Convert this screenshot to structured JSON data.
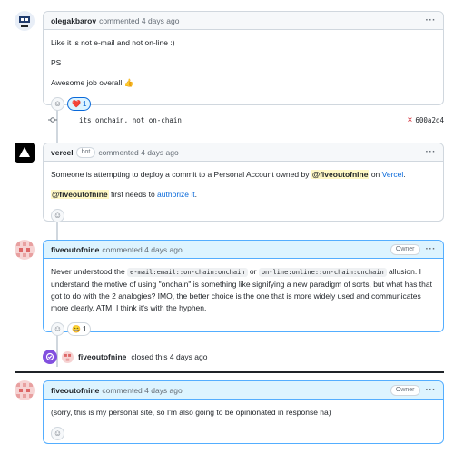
{
  "comment1": {
    "author": "olegakbarov",
    "meta": "commented 4 days ago",
    "lines": [
      "Like it is not e-mail and not on-line :)",
      "PS",
      "Awesome job overall 👍"
    ],
    "reactions": [
      {
        "emoji": "❤️",
        "count": "1"
      }
    ]
  },
  "commit": {
    "message": "its onchain, not on-chain",
    "status_icon": "×",
    "sha": "600a2d4"
  },
  "comment2": {
    "author": "vercel",
    "badge": "bot",
    "meta": "commented 4 days ago",
    "line1_pre": "Someone is attempting to deploy a commit to a Personal Account owned by ",
    "line1_mention": "@fiveoutofnine",
    "line1_mid": " on ",
    "line1_link": "Vercel",
    "line1_end": ".",
    "line2_mention": "@fiveoutofnine",
    "line2_mid": " first needs to ",
    "line2_link": "authorize it",
    "line2_end": "."
  },
  "comment3": {
    "author": "fiveoutofnine",
    "meta": "commented 4 days ago",
    "badge": "Owner",
    "t1": "Never understood the ",
    "code1": "e-mail:email::on-chain:onchain",
    "t2": " or ",
    "code2": "on-line:online::on-chain:onchain",
    "t3": " allusion. I understand the motive of using \"onchain\" is something like signifying a new paradigm of sorts, but what has that got to do with the 2 analogies? IMO, the better choice is the one that is more widely used and communicates more clearly. ATM, I think it's with the hyphen.",
    "reactions": [
      {
        "emoji": "😄",
        "count": "1"
      }
    ]
  },
  "closed_event": {
    "author": "fiveoutofnine",
    "text": "closed this 4 days ago"
  },
  "comment4": {
    "author": "fiveoutofnine",
    "meta": "commented 4 days ago",
    "badge": "Owner",
    "text": "(sorry, this is my personal site, so I'm also going to be opinionated in response ha)"
  },
  "ui": {
    "kebab": "···",
    "add_reaction_icon": "☺",
    "accent": "#0969da",
    "closed_color": "#8250df"
  }
}
